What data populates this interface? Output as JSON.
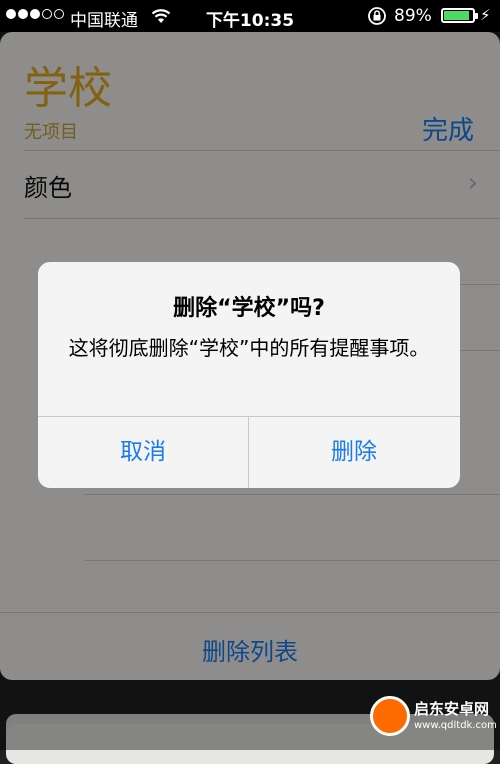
{
  "status_bar": {
    "carrier": "中国联通",
    "time": "下午10:35",
    "battery_percent": "89%",
    "signal_bars": 3,
    "signal_total": 5,
    "battery_level": 0.89
  },
  "list": {
    "title": "学校",
    "subtitle": "无项目",
    "done_label": "完成",
    "color_row_label": "颜色",
    "delete_list_label": "删除列表"
  },
  "alert": {
    "title": "删除“学校”吗?",
    "message": "这将彻底删除“学校”中的所有提醒事项。",
    "cancel_label": "取消",
    "delete_label": "删除"
  },
  "watermark": {
    "name": "启东安卓网",
    "url": "www.qdltdk.com"
  },
  "colors": {
    "accent_blue": "#1a7bf0",
    "list_title_gold": "#e0a91a",
    "battery_green": "#4cd964"
  }
}
